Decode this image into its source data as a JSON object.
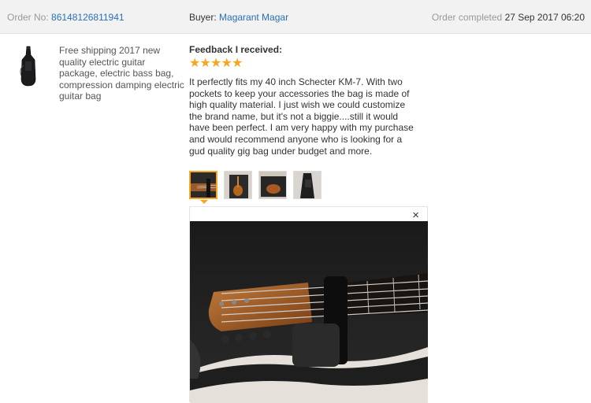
{
  "order": {
    "number_label": "Order No:",
    "number_value": "86148126811941",
    "buyer_label": "Buyer:",
    "buyer_name": "Magarant Magar",
    "status_label": "Order completed",
    "status_date": "27 Sep 2017 06:20"
  },
  "product": {
    "title": "Free shipping 2017 new quality electric guitar package, electric bass bag, compression damping electric guitar bag",
    "thumb_icon": "guitar-bag-icon"
  },
  "feedback": {
    "heading": "Feedback I received:",
    "rating": 5,
    "rating_max": 5,
    "star_color": "#f5a623",
    "text": "It perfectly fits my 40 inch Schecter KM-7. With two pockets to keep your accessories the bag is made of high quality material. I just wish we could customize the brand name, but it's not a biggie....still it would have been perfect. I am very happy with my purchase and would recommend anyone who is looking for a gud quality gig bag under budget and more."
  },
  "gallery": {
    "selected_index": 0,
    "count": 4,
    "close_symbol": "×"
  },
  "colors": {
    "link": "#2a6fb5",
    "accent": "#f5a623",
    "header_bg": "#f2f2f2"
  }
}
